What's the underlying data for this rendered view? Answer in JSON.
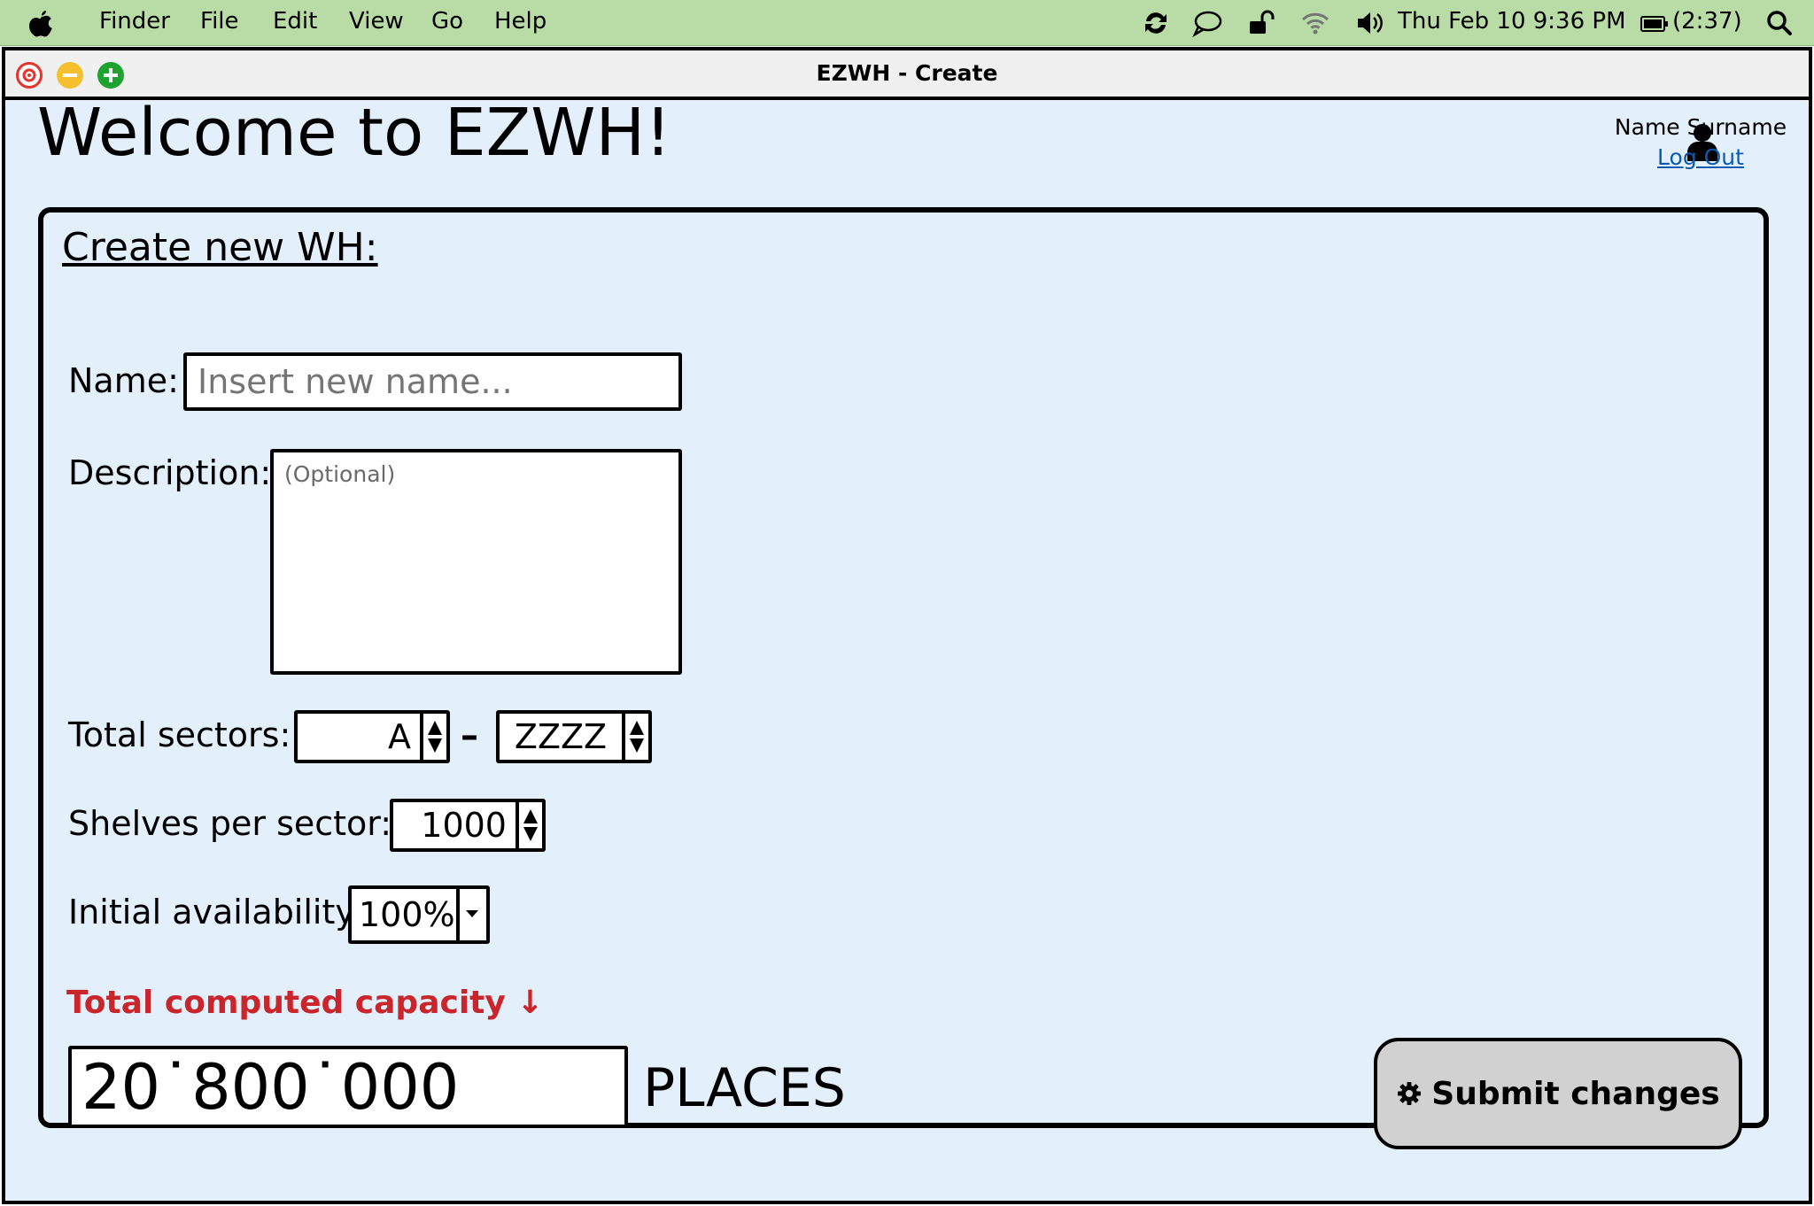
{
  "menubar": {
    "items": [
      "Finder",
      "File",
      "Edit",
      "View",
      "Go",
      "Help"
    ],
    "datetime": "Thu Feb 10  9:36 PM",
    "battery": "(2:37)"
  },
  "window": {
    "title": "EZWH - Create"
  },
  "header": {
    "welcome": "Welcome to EZWH!",
    "user_name": "Name Surname",
    "logout": "Log Out"
  },
  "form": {
    "title": "Create new WH:",
    "name_label": "Name:",
    "name_placeholder": "Insert new name...",
    "description_label": "Description:",
    "description_placeholder": "(Optional)",
    "sectors_label": "Total sectors:",
    "sector_from": "A",
    "sector_to": "ZZZZ",
    "sector_separator": "–",
    "shelves_label": "Shelves per sector:",
    "shelves_value": "1000",
    "availability_label": "Initial availability:",
    "availability_value": "100%",
    "capacity_label": "Total computed capacity ↓",
    "capacity_value": "20˙800˙000",
    "capacity_unit": "PLACES",
    "submit_label": "Submit changes"
  },
  "colors": {
    "menubar_bg": "#b9dba6",
    "window_bg": "#e3effb",
    "capacity_label": "#c9252b",
    "link": "#0a5bb5",
    "close": "#e5342c",
    "minimize": "#f5c02f",
    "zoom": "#1fa330"
  }
}
